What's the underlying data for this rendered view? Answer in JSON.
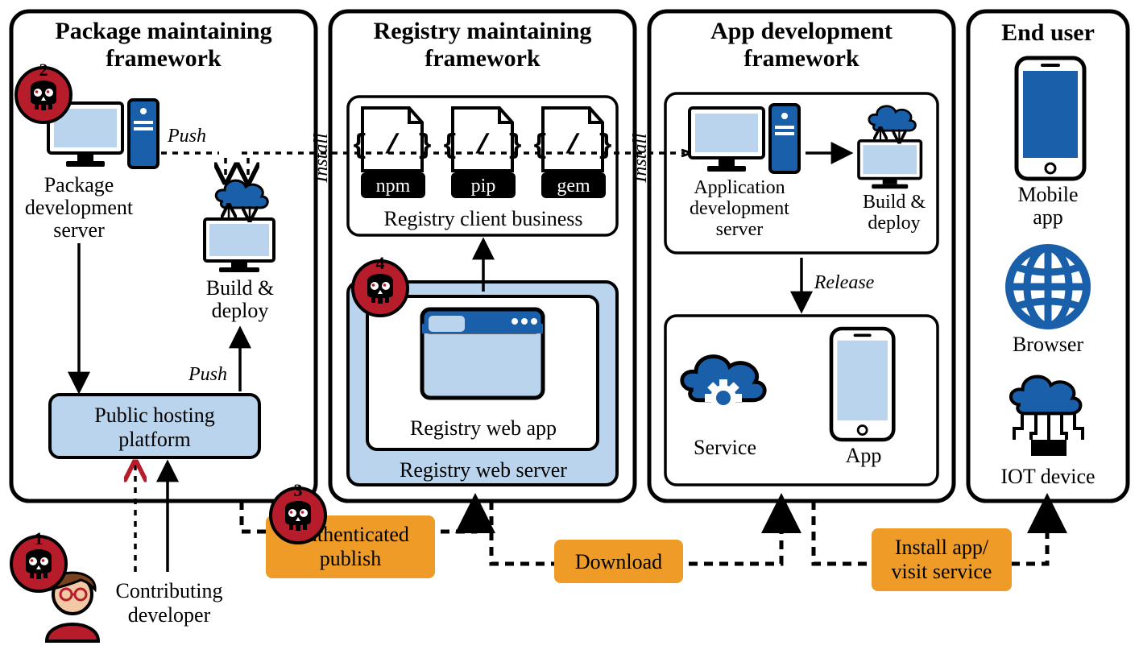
{
  "col1": {
    "title_l1": "Package maintaining",
    "title_l2": "framework",
    "dev_server_l1": "Package",
    "dev_server_l2": "development",
    "dev_server_l3": "server",
    "build_l1": "Build &",
    "build_l2": "deploy",
    "push1": "Push",
    "push2": "Push",
    "hosting_l1": "Public hosting",
    "hosting_l2": "platform",
    "contrib_l1": "Contributing",
    "contrib_l2": "developer"
  },
  "col2": {
    "title_l1": "Registry maintaining",
    "title_l2": "framework",
    "pkg1": "npm",
    "pkg2": "pip",
    "pkg3": "gem",
    "client_label": "Registry client business",
    "webapp": "Registry web app",
    "webserver": "Registry web server",
    "install_left": "Install",
    "install_right": "Install"
  },
  "col3": {
    "title_l1": "App development",
    "title_l2": "framework",
    "dev_server_l1": "Application",
    "dev_server_l2": "development",
    "dev_server_l3": "server",
    "build_l1": "Build &",
    "build_l2": "deploy",
    "release": "Release",
    "service": "Service",
    "app": "App"
  },
  "col4": {
    "title": "End user",
    "mobile_l1": "Mobile",
    "mobile_l2": "app",
    "browser": "Browser",
    "iot": "IOT device"
  },
  "lane": {
    "auth_l1": "Authenticated",
    "auth_l2": "publish",
    "download": "Download",
    "install_l1": "Install app/",
    "install_l2": "visit service"
  },
  "threats": {
    "t1": "1",
    "t2": "2",
    "t3": "3",
    "t4": "4"
  }
}
